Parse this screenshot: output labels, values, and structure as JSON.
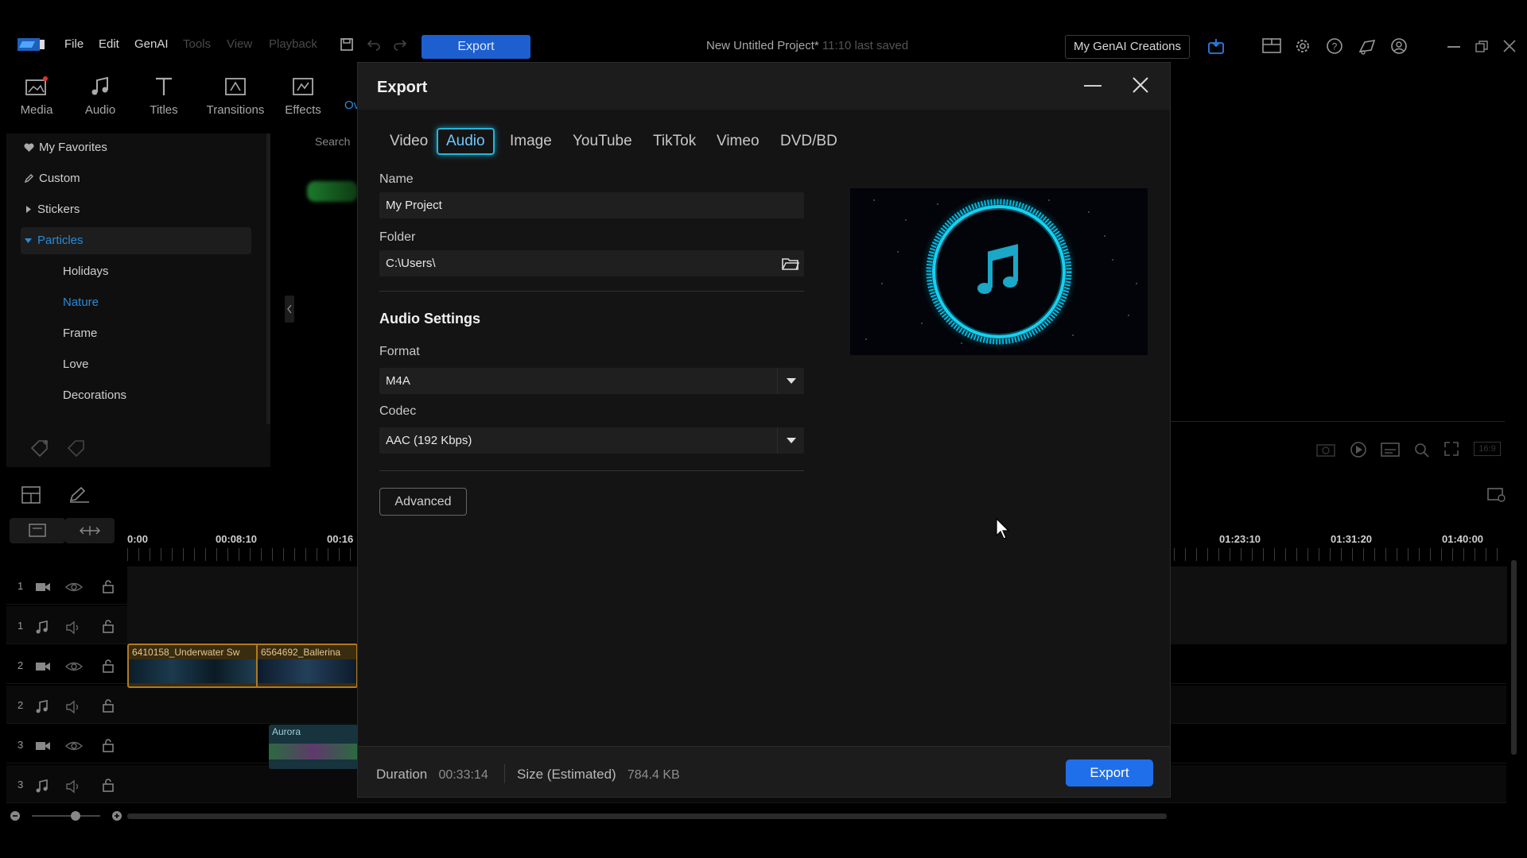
{
  "menu": {
    "items": [
      "File",
      "Edit",
      "GenAI",
      "Tools",
      "View",
      "Playback"
    ],
    "export_label": "Export",
    "project_title": "New Untitled Project*",
    "last_saved": "11:10 last saved",
    "genai_creations_label": "My GenAI Creations"
  },
  "tools": {
    "media": "Media",
    "audio": "Audio",
    "titles": "Titles",
    "transitions": "Transitions",
    "effects": "Effects",
    "overlays_partial": "Ov"
  },
  "library": {
    "search_placeholder_partial": "Search",
    "items": {
      "favorites": "My Favorites",
      "custom": "Custom",
      "stickers": "Stickers",
      "particles": "Particles"
    },
    "subitems": {
      "holidays": "Holidays",
      "nature": "Nature",
      "frame": "Frame",
      "love": "Love",
      "decorations": "Decorations"
    }
  },
  "timeline": {
    "ruler": {
      "t0": "0:00",
      "t1": "00:08:10",
      "t2": "00:16",
      "t3": "01:23:10",
      "t4": "01:31:20",
      "t5": "01:40:00"
    },
    "track_numbers": [
      "1",
      "1",
      "2",
      "2",
      "3",
      "3"
    ],
    "clips": {
      "clip1": "6410158_Underwater Sw",
      "clip2": "6564692_Ballerina",
      "clip3": "Aurora"
    },
    "aspect_label": "16:9"
  },
  "dialog": {
    "title": "Export",
    "tabs": {
      "video": "Video",
      "audio": "Audio",
      "image": "Image",
      "youtube": "YouTube",
      "tiktok": "TikTok",
      "vimeo": "Vimeo",
      "dvd": "DVD/BD"
    },
    "name_label": "Name",
    "name_value": "My Project",
    "folder_label": "Folder",
    "folder_value": "C:\\Users\\",
    "audio_settings_heading": "Audio Settings",
    "format_label": "Format",
    "format_value": "M4A",
    "codec_label": "Codec",
    "codec_value": "AAC (192 Kbps)",
    "advanced_label": "Advanced",
    "duration_label": "Duration",
    "duration_value": "00:33:14",
    "size_label": "Size (Estimated)",
    "size_value": "784.4 KB",
    "export_label": "Export",
    "active_tab_color": "#27b5d8",
    "export_color": "#1f6fea"
  }
}
